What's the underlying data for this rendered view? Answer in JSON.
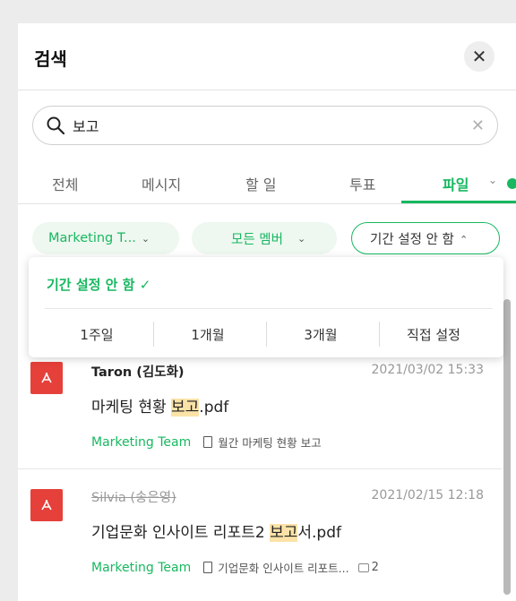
{
  "header": {
    "title": "검색",
    "close_symbol": "✕"
  },
  "search": {
    "value": "보고",
    "clear_symbol": "✕"
  },
  "tabs": [
    {
      "label": "전체",
      "active": false
    },
    {
      "label": "메시지",
      "active": false
    },
    {
      "label": "할 일",
      "active": false
    },
    {
      "label": "투표",
      "active": false
    },
    {
      "label": "파일",
      "active": true
    }
  ],
  "tab_chevron": "⌄",
  "filters": {
    "team": "Marketing T...",
    "members": "모든 멤버",
    "period": "기간 설정 안 함",
    "chevron": "⌄"
  },
  "period_dropdown": {
    "selected": "기간 설정 안 함 ✓",
    "options": [
      "1주일",
      "1개월",
      "3개월",
      "직접 설정"
    ]
  },
  "results": [
    {
      "sender": "Taron (김도화)",
      "date": "2021/03/02 15:33",
      "file_pre": "마케팅 현황 ",
      "file_hl": "보고",
      "file_post": ".pdf",
      "team": "Marketing Team",
      "doc_title": "월간 마케팅 현황 보고",
      "comments": ""
    },
    {
      "sender": "Silvia (송은영)",
      "date": "2021/02/15 12:18",
      "file_pre": "기업문화 인사이트 리포트2 ",
      "file_hl": "보고",
      "file_post": "서.pdf",
      "team": "Marketing Team",
      "doc_title": "기업문화 인사이트 리포트...",
      "comments": "2"
    }
  ],
  "colors": {
    "accent": "#17b860",
    "pdf": "#e5403a",
    "highlight": "#fbe3a8"
  }
}
